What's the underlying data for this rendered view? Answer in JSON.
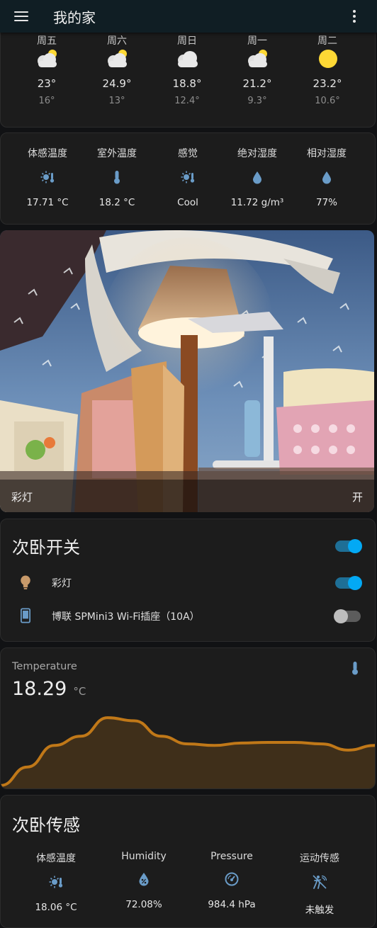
{
  "app": {
    "title": "我的家"
  },
  "forecast": [
    {
      "day": "周五",
      "icon": "partly-cloudy-icon",
      "high": "23°",
      "low": "16°"
    },
    {
      "day": "周六",
      "icon": "partly-cloudy-icon",
      "high": "24.9°",
      "low": "13°"
    },
    {
      "day": "周日",
      "icon": "cloudy-icon",
      "high": "18.8°",
      "low": "12.4°"
    },
    {
      "day": "周一",
      "icon": "partly-cloudy-icon",
      "high": "21.2°",
      "low": "9.3°"
    },
    {
      "day": "周二",
      "icon": "sunny-icon",
      "high": "23.2°",
      "low": "10.6°"
    }
  ],
  "sensors": [
    {
      "label": "体感温度",
      "icon": "sun-thermometer-icon",
      "value": "17.71 °C"
    },
    {
      "label": "室外温度",
      "icon": "thermometer-icon",
      "value": "18.2 °C"
    },
    {
      "label": "感觉",
      "icon": "sun-thermometer-icon",
      "value": "Cool"
    },
    {
      "label": "绝对湿度",
      "icon": "water-drop-icon",
      "value": "11.72 g/m³"
    },
    {
      "label": "相对湿度",
      "icon": "water-drop-icon",
      "value": "77%"
    }
  ],
  "picture": {
    "name": "彩灯",
    "state": "开"
  },
  "switches": {
    "title": "次卧开关",
    "master_on": true,
    "items": [
      {
        "name": "彩灯",
        "icon": "lightbulb-icon",
        "on": true
      },
      {
        "name": "博联 SPMini3 Wi-Fi插座（10A）",
        "icon": "phone-icon",
        "on": false
      }
    ]
  },
  "temperature_card": {
    "name": "Temperature",
    "value": "18.29",
    "unit": "°C",
    "icon": "thermometer-icon"
  },
  "chart_data": {
    "type": "area",
    "series": [
      {
        "values": [
          17.0,
          17.6,
          18.3,
          18.6,
          19.2,
          19.1,
          18.6,
          18.35,
          18.3,
          18.38,
          18.4,
          18.4,
          18.35,
          18.15,
          18.3
        ]
      }
    ]
  },
  "sensor_card": {
    "title": "次卧传感",
    "items": [
      {
        "label": "体感温度",
        "icon": "sun-thermometer-icon",
        "value": "18.06 °C"
      },
      {
        "label": "Humidity",
        "icon": "humidity-percent-icon",
        "value": "72.08%"
      },
      {
        "label": "Pressure",
        "icon": "gauge-icon",
        "value": "984.4 hPa"
      },
      {
        "label": "运动传感",
        "icon": "motion-sensor-off-icon",
        "value": "未触发"
      }
    ]
  },
  "colors": {
    "accent_blue": "#03a9f4",
    "chart_line": "#c07818",
    "sun_yellow": "#fdd835",
    "icon_blue": "#6a9cc8",
    "bulb_orange": "#c89a6a"
  }
}
